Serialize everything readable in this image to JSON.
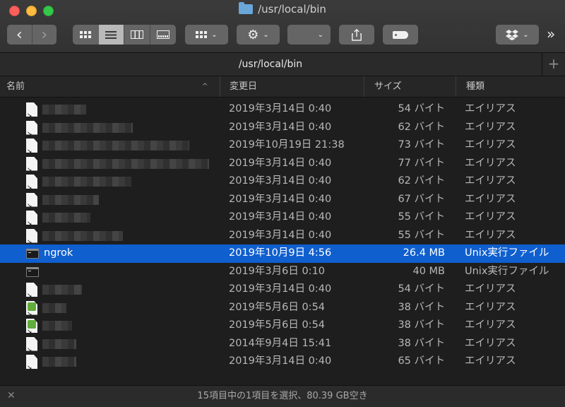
{
  "window": {
    "title": "/usr/local/bin",
    "path_title": "/usr/local/bin"
  },
  "toolbar": {
    "back_glyph": "‹",
    "forward_glyph": "›",
    "overflow_glyph": "»",
    "chevron": "⌄"
  },
  "icons": {
    "back": "chevron-left-icon",
    "forward": "chevron-right-icon",
    "view_icons": "grid-icon",
    "view_list": "list-icon",
    "view_columns": "columns-icon",
    "view_gallery": "gallery-icon",
    "group": "group-icon",
    "action": "gear-icon",
    "share": "share-icon",
    "tag": "tag-icon",
    "dropbox": "dropbox-icon",
    "add_tab": "plus-icon",
    "status_tools": "wrench-icon"
  },
  "columns": {
    "name": "名前",
    "date": "変更日",
    "size": "サイズ",
    "kind": "種類",
    "sort_indicator": "^"
  },
  "rows": [
    {
      "name": "",
      "date": "2019年3月14日 0:40",
      "size": "54 バイト",
      "kind": "エイリアス",
      "icon": "alias-doc-icon"
    },
    {
      "name": "",
      "date": "2019年3月14日 0:40",
      "size": "62 バイト",
      "kind": "エイリアス",
      "icon": "alias-doc-icon"
    },
    {
      "name": "",
      "date": "2019年10月19日 21:38",
      "size": "73 バイト",
      "kind": "エイリアス",
      "icon": "alias-doc-icon"
    },
    {
      "name": "",
      "date": "2019年3月14日 0:40",
      "size": "77 バイト",
      "kind": "エイリアス",
      "icon": "alias-doc-icon"
    },
    {
      "name": "",
      "date": "2019年3月14日 0:40",
      "size": "62 バイト",
      "kind": "エイリアス",
      "icon": "alias-doc-icon"
    },
    {
      "name": "",
      "date": "2019年3月14日 0:40",
      "size": "67 バイト",
      "kind": "エイリアス",
      "icon": "alias-doc-icon"
    },
    {
      "name": "",
      "date": "2019年3月14日 0:40",
      "size": "55 バイト",
      "kind": "エイリアス",
      "icon": "alias-doc-icon"
    },
    {
      "name": "",
      "date": "2019年3月14日 0:40",
      "size": "55 バイト",
      "kind": "エイリアス",
      "icon": "alias-doc-icon"
    },
    {
      "name": "ngrok",
      "date": "2019年10月9日 4:56",
      "size": "26.4 MB",
      "kind": "Unix実行ファイル",
      "icon": "terminal-exec-icon",
      "selected": true
    },
    {
      "name": "",
      "date": "2019年3月6日 0:10",
      "size": "40 MB",
      "kind": "Unix実行ファイル",
      "icon": "terminal-exec-icon"
    },
    {
      "name": "",
      "date": "2019年3月14日 0:40",
      "size": "54 バイト",
      "kind": "エイリアス",
      "icon": "alias-doc-icon"
    },
    {
      "name": "",
      "date": "2019年5月6日 0:54",
      "size": "38 バイト",
      "kind": "エイリアス",
      "icon": "alias-script-icon"
    },
    {
      "name": "",
      "date": "2019年5月6日 0:54",
      "size": "38 バイト",
      "kind": "エイリアス",
      "icon": "alias-script-icon"
    },
    {
      "name": "",
      "date": "2014年9月4日 15:41",
      "size": "38 バイト",
      "kind": "エイリアス",
      "icon": "alias-doc-icon"
    },
    {
      "name": "",
      "date": "2019年3月14日 0:40",
      "size": "65 バイト",
      "kind": "エイリアス",
      "icon": "alias-doc-icon"
    }
  ],
  "status": {
    "text": "15項目中の1項目を選択、80.39 GB空き"
  },
  "colors": {
    "selection": "#0f5fcf",
    "background": "#1e1e1e",
    "toolbar_button": "#656565"
  }
}
